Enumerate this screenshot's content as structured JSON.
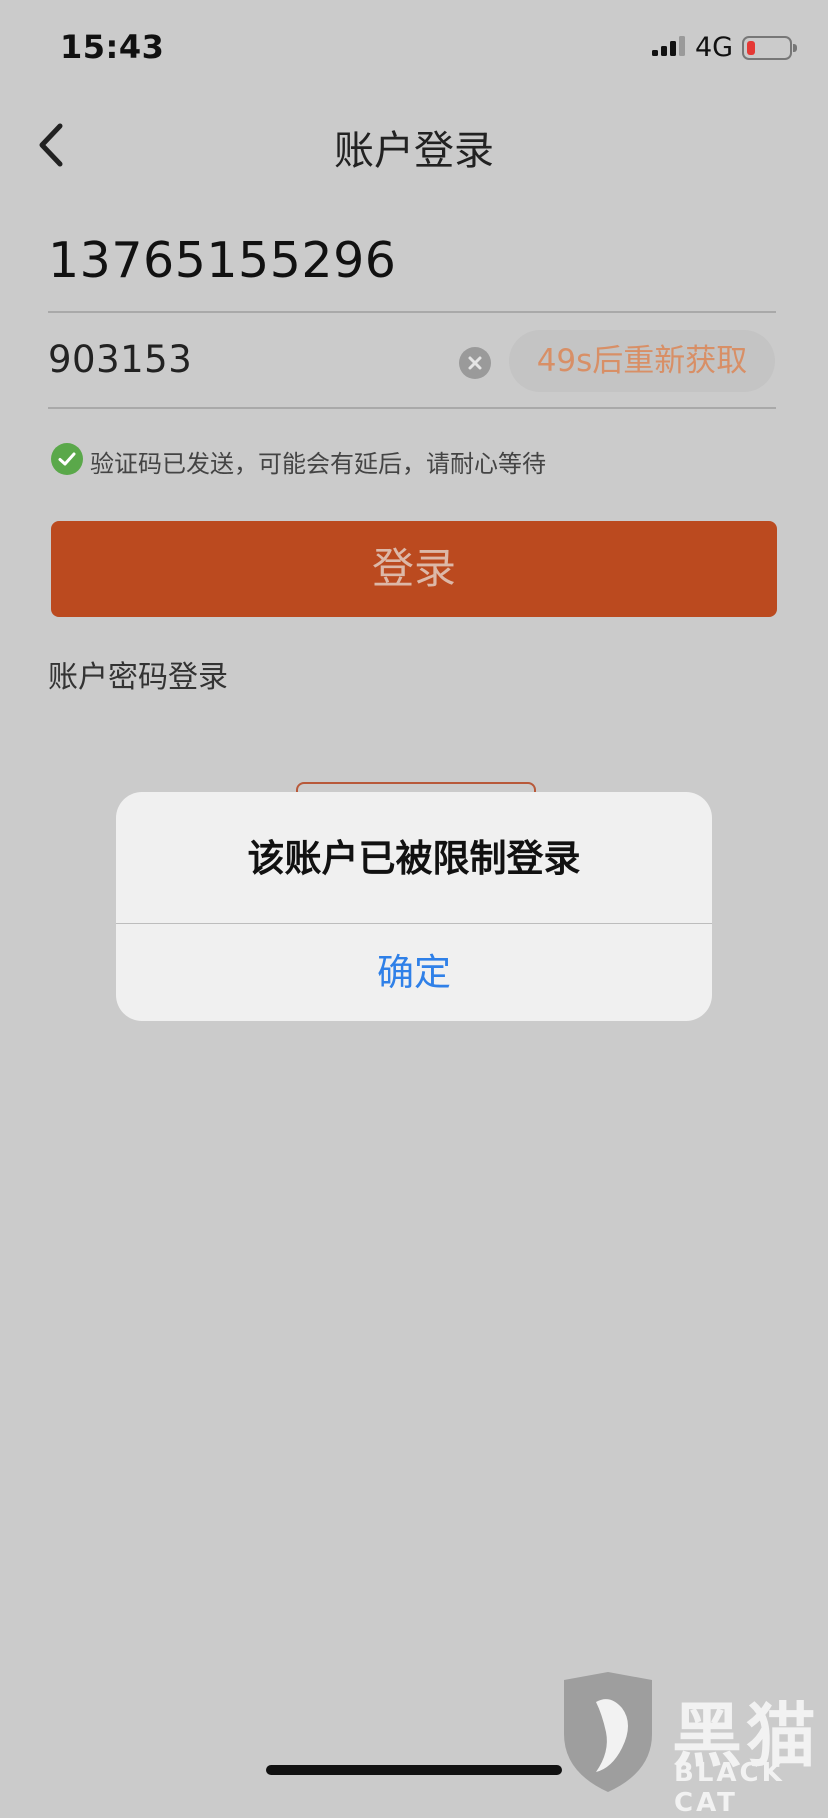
{
  "status_bar": {
    "time": "15:43",
    "network": "4G",
    "signal_icon": "cellular-signal-icon",
    "battery_icon": "battery-low-icon"
  },
  "nav": {
    "back_icon": "chevron-left-icon",
    "title": "账户登录"
  },
  "form": {
    "phone_value": "13765155296",
    "code_value": "903153",
    "clear_icon": "clear-circle-icon",
    "resend_label": "49s后重新获取",
    "sent_hint": "验证码已发送，可能会有延后，请耐心等待",
    "check_icon": "check-circle-icon",
    "login_label": "登录",
    "password_login_link": "账户密码登录"
  },
  "dialog": {
    "message": "该账户已被限制登录",
    "confirm_label": "确定"
  },
  "watermark": {
    "text": "黑猫",
    "subtext": "BLACK CAT",
    "logo_icon": "black-cat-shield-icon"
  },
  "colors": {
    "accent": "#bb4a1f",
    "dialog_button": "#2f80e8",
    "success": "#5aa84a",
    "battery_low": "#e53935"
  }
}
